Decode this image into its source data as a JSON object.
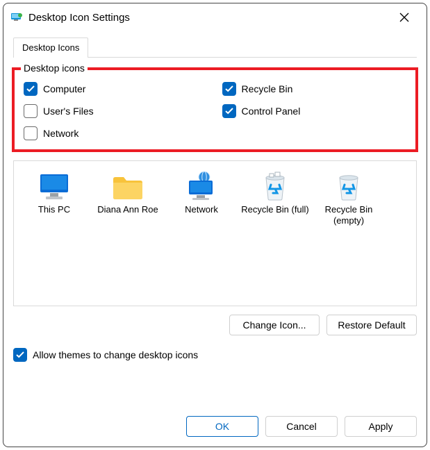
{
  "window": {
    "title": "Desktop Icon Settings"
  },
  "tabs": {
    "desktop_icons": "Desktop Icons"
  },
  "group": {
    "title": "Desktop icons",
    "items": {
      "computer": {
        "label": "Computer",
        "checked": true
      },
      "users_files": {
        "label": "User's Files",
        "checked": false
      },
      "network": {
        "label": "Network",
        "checked": false
      },
      "recycle_bin": {
        "label": "Recycle Bin",
        "checked": true
      },
      "control_panel": {
        "label": "Control Panel",
        "checked": true
      }
    }
  },
  "preview": {
    "this_pc": "This PC",
    "user_folder": "Diana Ann Roe",
    "network": "Network",
    "recycle_full": "Recycle Bin (full)",
    "recycle_empty": "Recycle Bin (empty)"
  },
  "buttons": {
    "change_icon": "Change Icon...",
    "restore_default": "Restore Default",
    "ok": "OK",
    "cancel": "Cancel",
    "apply": "Apply"
  },
  "allow_themes": {
    "label": "Allow themes to change desktop icons",
    "checked": true
  }
}
